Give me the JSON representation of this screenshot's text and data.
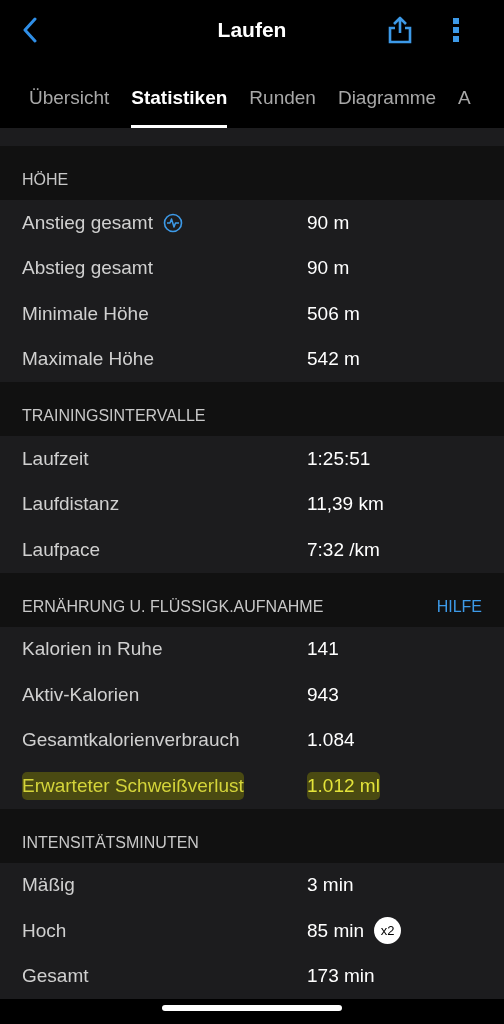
{
  "header": {
    "title": "Laufen"
  },
  "tabs": [
    {
      "label": "Übersicht",
      "selected": false
    },
    {
      "label": "Statistiken",
      "selected": true
    },
    {
      "label": "Runden",
      "selected": false
    },
    {
      "label": "Diagramme",
      "selected": false
    },
    {
      "label": "A",
      "selected": false
    }
  ],
  "sections": [
    {
      "title": "HÖHE",
      "rows": [
        {
          "label": "Anstieg gesamt",
          "value": "90 m",
          "chart_icon": true
        },
        {
          "label": "Abstieg gesamt",
          "value": "90 m"
        },
        {
          "label": "Minimale Höhe",
          "value": "506 m"
        },
        {
          "label": "Maximale Höhe",
          "value": "542 m"
        }
      ]
    },
    {
      "title": "TRAININGSINTERVALLE",
      "rows": [
        {
          "label": "Laufzeit",
          "value": "1:25:51"
        },
        {
          "label": "Laufdistanz",
          "value": "11,39 km"
        },
        {
          "label": "Laufpace",
          "value": "7:32 /km"
        }
      ]
    },
    {
      "title": "ERNÄHRUNG U. FLÜSSIGK.AUFNAHME",
      "link": "HILFE",
      "rows": [
        {
          "label": "Kalorien in Ruhe",
          "value": "141"
        },
        {
          "label": "Aktiv-Kalorien",
          "value": "943"
        },
        {
          "label": "Gesamtkalorienverbrauch",
          "value": "1.084"
        },
        {
          "label": "Erwarteter Schweißverlust",
          "value": "1.012 ml",
          "highlighted": true
        }
      ]
    },
    {
      "title": "INTENSITÄTSMINUTEN",
      "rows": [
        {
          "label": "Mäßig",
          "value": "3 min"
        },
        {
          "label": "Hoch",
          "value": "85 min",
          "badge": "x2"
        },
        {
          "label": "Gesamt",
          "value": "173 min"
        }
      ]
    }
  ]
}
